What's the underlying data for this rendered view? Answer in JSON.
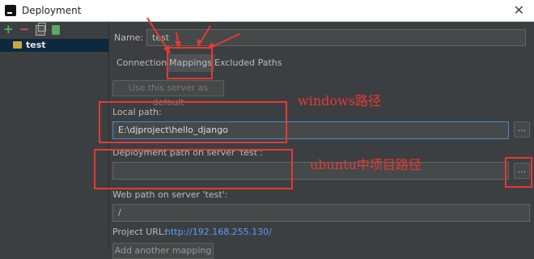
{
  "window": {
    "title": "Deployment"
  },
  "servers": [
    {
      "name": "test"
    }
  ],
  "form": {
    "name_label": "Name:",
    "name_value": "test",
    "tabs": [
      {
        "label": "Connection",
        "active": false
      },
      {
        "label": "Mappings",
        "active": true
      },
      {
        "label": "Excluded Paths",
        "active": false
      }
    ],
    "default_button": "Use this server as default",
    "local_path_label": "Local path:",
    "local_path_value": "E:\\djproject\\hello_django",
    "deployment_path_label": "Deployment path on server 'test':",
    "deployment_path_value": "",
    "web_path_label": "Web path on server 'test':",
    "web_path_value": "/",
    "project_url_label": "Project URL:",
    "project_url_value": "http://192.168.255.130/",
    "add_mapping_button": "Add another mapping",
    "browse_label": "..."
  },
  "annotations": {
    "windows_note": "windows路径",
    "ubuntu_note": "ubuntu中项目路径",
    "color": "#e53935"
  },
  "icons": [
    "app-icon",
    "close-icon",
    "add-icon",
    "remove-icon",
    "copy-icon",
    "default-server-icon",
    "server-icon"
  ]
}
